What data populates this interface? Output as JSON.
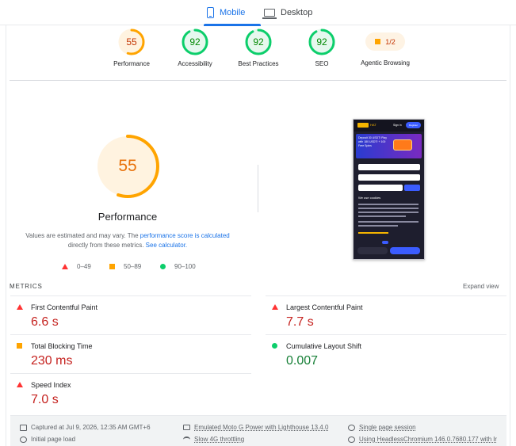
{
  "tabs": [
    {
      "label": "Mobile",
      "icon": "phone-icon",
      "active": true
    },
    {
      "label": "Desktop",
      "icon": "desktop-icon",
      "active": false
    }
  ],
  "summary_gauges": [
    {
      "name": "performance",
      "value": "55",
      "label": "Performance",
      "color": "#ffa400",
      "fill": 0.55
    },
    {
      "name": "accessibility",
      "value": "92",
      "label": "Accessibility",
      "color": "#0cce6b",
      "fill": 0.92
    },
    {
      "name": "best-practices",
      "value": "92",
      "label": "Best Practices",
      "color": "#0cce6b",
      "fill": 0.92
    },
    {
      "name": "seo",
      "value": "92",
      "label": "SEO",
      "color": "#0cce6b",
      "fill": 0.92
    }
  ],
  "agentic": {
    "value": "1/2",
    "label": "Agentic Browsing"
  },
  "performance": {
    "score": "55",
    "fill": 0.55,
    "title": "Performance",
    "note_prefix": "Values are estimated and may vary. The ",
    "note_link1": "performance score is calculated",
    "note_middle": " directly from these metrics. ",
    "note_link2": "See calculator."
  },
  "legend": [
    {
      "label": "0–49",
      "shape": "triangle",
      "color": "#ff3333"
    },
    {
      "label": "50–89",
      "shape": "square",
      "color": "#ffa400"
    },
    {
      "label": "90–100",
      "shape": "circle",
      "color": "#0cce6b"
    }
  ],
  "screenshot": {
    "logo": "HAT",
    "sign_in": "Sign in",
    "register": "Register",
    "hero_text": "Deposit 30 USDT! Play with 180 USDT! + 100 Free Spins",
    "cookie_heading": "We use cookies"
  },
  "metrics": {
    "heading": "METRICS",
    "expand": "Expand view",
    "items": [
      {
        "name": "First Contentful Paint",
        "value": "6.6 s",
        "status": "red"
      },
      {
        "name": "Largest Contentful Paint",
        "value": "7.7 s",
        "status": "red"
      },
      {
        "name": "Total Blocking Time",
        "value": "230 ms",
        "status": "orange"
      },
      {
        "name": "Cumulative Layout Shift",
        "value": "0.007",
        "status": "green"
      },
      {
        "name": "Speed Index",
        "value": "7.0 s",
        "status": "red"
      }
    ]
  },
  "footer": {
    "captured": "Captured at Jul 9, 2026, 12:35 AM GMT+6",
    "initial_load": "Initial page load",
    "device": "Emulated Moto G Power with Lighthouse 13.4.0",
    "throttling": "Slow 4G throttling",
    "session": "Single page session",
    "browser": "Using HeadlessChromium 146.0.7680.177 with lr"
  }
}
